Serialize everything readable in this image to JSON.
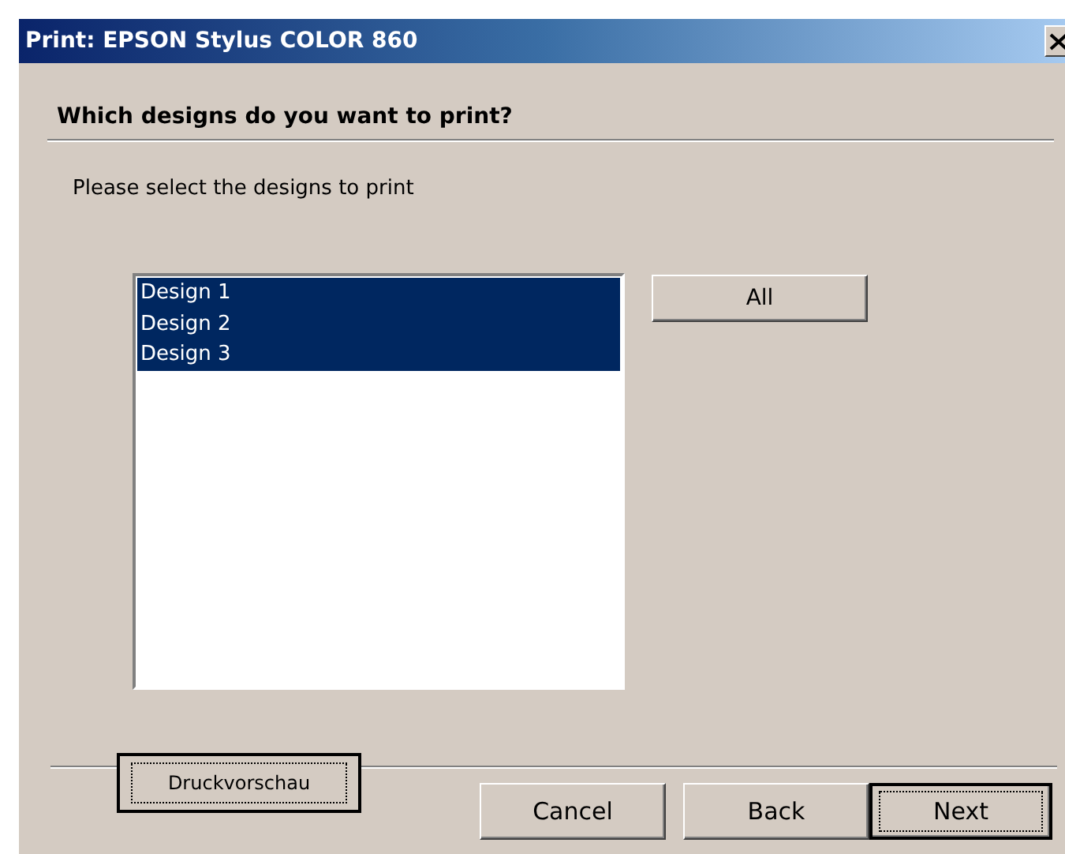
{
  "window": {
    "title": "Print: EPSON Stylus COLOR 860"
  },
  "heading": "Which designs do you want to print?",
  "instruction": "Please select the designs to print",
  "designs": [
    {
      "label": "Design 1",
      "selected": true
    },
    {
      "label": "Design 2",
      "selected": true
    },
    {
      "label": "Design 3",
      "selected": true
    }
  ],
  "all_button": "All",
  "preview_button": "Druckvorschau",
  "buttons": [
    {
      "label": "Cancel",
      "default": false
    },
    {
      "label": "Back",
      "default": false
    },
    {
      "label": "Next",
      "default": true
    }
  ]
}
